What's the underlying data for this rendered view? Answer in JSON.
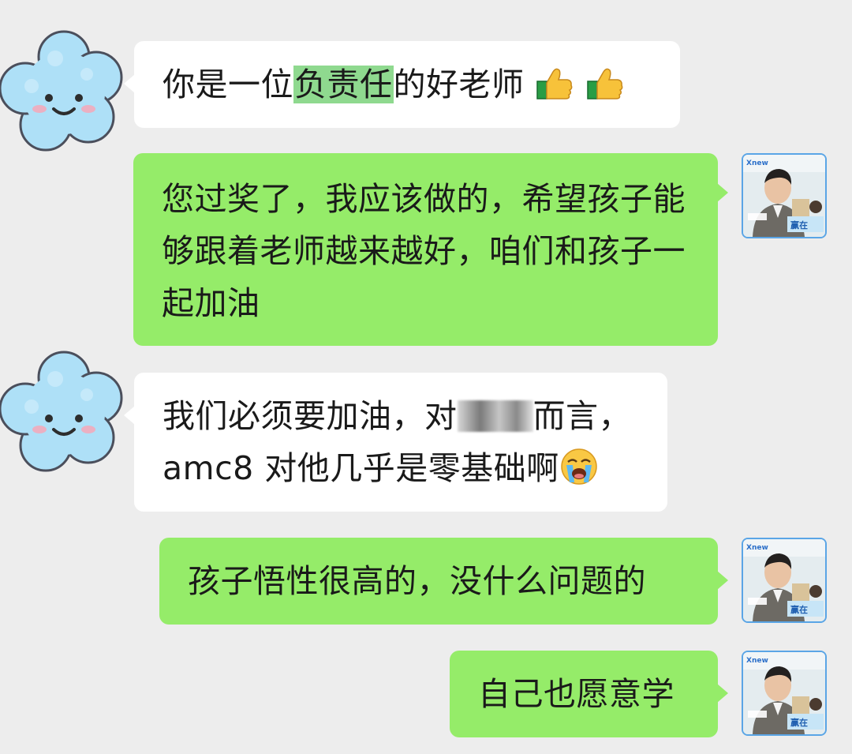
{
  "messages": [
    {
      "side": "incoming",
      "sender": "parent",
      "before": "你是一位",
      "highlight": "负责任",
      "after": "的好老师",
      "emoji": [
        "thumbs-up-icon",
        "thumbs-up-icon"
      ]
    },
    {
      "side": "outgoing",
      "sender": "teacher",
      "text": "您过奖了，我应该做的，希望孩子能够跟着老师越来越好，咱们和孩子一起加油"
    },
    {
      "side": "incoming",
      "sender": "parent",
      "before": "我们必须要加油，对",
      "after": "而言，amc8 对他几乎是零基础啊",
      "redacted": true,
      "emoji": [
        "loudly-crying-face-icon"
      ]
    },
    {
      "side": "outgoing",
      "sender": "teacher",
      "text": "孩子悟性很高的，没什么问题的"
    },
    {
      "side": "outgoing",
      "sender": "teacher",
      "text": "自己也愿意学"
    }
  ],
  "avatars": {
    "parent": "cloud-avatar",
    "teacher": "teacher-photo-avatar"
  },
  "colors": {
    "background": "#ededed",
    "incoming_bubble": "#ffffff",
    "outgoing_bubble": "#95ec69",
    "highlight": "#8fd98f"
  }
}
